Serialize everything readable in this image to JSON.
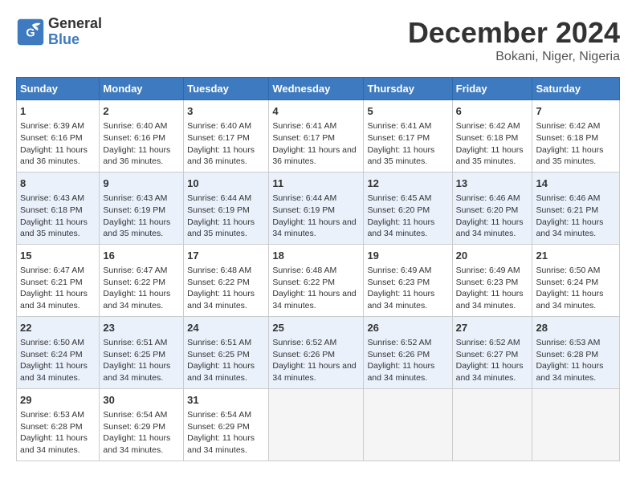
{
  "logo": {
    "line1": "General",
    "line2": "Blue"
  },
  "title": "December 2024",
  "subtitle": "Bokani, Niger, Nigeria",
  "days_of_week": [
    "Sunday",
    "Monday",
    "Tuesday",
    "Wednesday",
    "Thursday",
    "Friday",
    "Saturday"
  ],
  "weeks": [
    [
      {
        "day": 1,
        "sunrise": "6:39 AM",
        "sunset": "6:16 PM",
        "daylight": "11 hours and 36 minutes."
      },
      {
        "day": 2,
        "sunrise": "6:40 AM",
        "sunset": "6:16 PM",
        "daylight": "11 hours and 36 minutes."
      },
      {
        "day": 3,
        "sunrise": "6:40 AM",
        "sunset": "6:17 PM",
        "daylight": "11 hours and 36 minutes."
      },
      {
        "day": 4,
        "sunrise": "6:41 AM",
        "sunset": "6:17 PM",
        "daylight": "11 hours and 36 minutes."
      },
      {
        "day": 5,
        "sunrise": "6:41 AM",
        "sunset": "6:17 PM",
        "daylight": "11 hours and 35 minutes."
      },
      {
        "day": 6,
        "sunrise": "6:42 AM",
        "sunset": "6:18 PM",
        "daylight": "11 hours and 35 minutes."
      },
      {
        "day": 7,
        "sunrise": "6:42 AM",
        "sunset": "6:18 PM",
        "daylight": "11 hours and 35 minutes."
      }
    ],
    [
      {
        "day": 8,
        "sunrise": "6:43 AM",
        "sunset": "6:18 PM",
        "daylight": "11 hours and 35 minutes."
      },
      {
        "day": 9,
        "sunrise": "6:43 AM",
        "sunset": "6:19 PM",
        "daylight": "11 hours and 35 minutes."
      },
      {
        "day": 10,
        "sunrise": "6:44 AM",
        "sunset": "6:19 PM",
        "daylight": "11 hours and 35 minutes."
      },
      {
        "day": 11,
        "sunrise": "6:44 AM",
        "sunset": "6:19 PM",
        "daylight": "11 hours and 34 minutes."
      },
      {
        "day": 12,
        "sunrise": "6:45 AM",
        "sunset": "6:20 PM",
        "daylight": "11 hours and 34 minutes."
      },
      {
        "day": 13,
        "sunrise": "6:46 AM",
        "sunset": "6:20 PM",
        "daylight": "11 hours and 34 minutes."
      },
      {
        "day": 14,
        "sunrise": "6:46 AM",
        "sunset": "6:21 PM",
        "daylight": "11 hours and 34 minutes."
      }
    ],
    [
      {
        "day": 15,
        "sunrise": "6:47 AM",
        "sunset": "6:21 PM",
        "daylight": "11 hours and 34 minutes."
      },
      {
        "day": 16,
        "sunrise": "6:47 AM",
        "sunset": "6:22 PM",
        "daylight": "11 hours and 34 minutes."
      },
      {
        "day": 17,
        "sunrise": "6:48 AM",
        "sunset": "6:22 PM",
        "daylight": "11 hours and 34 minutes."
      },
      {
        "day": 18,
        "sunrise": "6:48 AM",
        "sunset": "6:22 PM",
        "daylight": "11 hours and 34 minutes."
      },
      {
        "day": 19,
        "sunrise": "6:49 AM",
        "sunset": "6:23 PM",
        "daylight": "11 hours and 34 minutes."
      },
      {
        "day": 20,
        "sunrise": "6:49 AM",
        "sunset": "6:23 PM",
        "daylight": "11 hours and 34 minutes."
      },
      {
        "day": 21,
        "sunrise": "6:50 AM",
        "sunset": "6:24 PM",
        "daylight": "11 hours and 34 minutes."
      }
    ],
    [
      {
        "day": 22,
        "sunrise": "6:50 AM",
        "sunset": "6:24 PM",
        "daylight": "11 hours and 34 minutes."
      },
      {
        "day": 23,
        "sunrise": "6:51 AM",
        "sunset": "6:25 PM",
        "daylight": "11 hours and 34 minutes."
      },
      {
        "day": 24,
        "sunrise": "6:51 AM",
        "sunset": "6:25 PM",
        "daylight": "11 hours and 34 minutes."
      },
      {
        "day": 25,
        "sunrise": "6:52 AM",
        "sunset": "6:26 PM",
        "daylight": "11 hours and 34 minutes."
      },
      {
        "day": 26,
        "sunrise": "6:52 AM",
        "sunset": "6:26 PM",
        "daylight": "11 hours and 34 minutes."
      },
      {
        "day": 27,
        "sunrise": "6:52 AM",
        "sunset": "6:27 PM",
        "daylight": "11 hours and 34 minutes."
      },
      {
        "day": 28,
        "sunrise": "6:53 AM",
        "sunset": "6:28 PM",
        "daylight": "11 hours and 34 minutes."
      }
    ],
    [
      {
        "day": 29,
        "sunrise": "6:53 AM",
        "sunset": "6:28 PM",
        "daylight": "11 hours and 34 minutes."
      },
      {
        "day": 30,
        "sunrise": "6:54 AM",
        "sunset": "6:29 PM",
        "daylight": "11 hours and 34 minutes."
      },
      {
        "day": 31,
        "sunrise": "6:54 AM",
        "sunset": "6:29 PM",
        "daylight": "11 hours and 34 minutes."
      },
      null,
      null,
      null,
      null
    ]
  ],
  "labels": {
    "sunrise": "Sunrise:",
    "sunset": "Sunset:",
    "daylight": "Daylight:"
  }
}
